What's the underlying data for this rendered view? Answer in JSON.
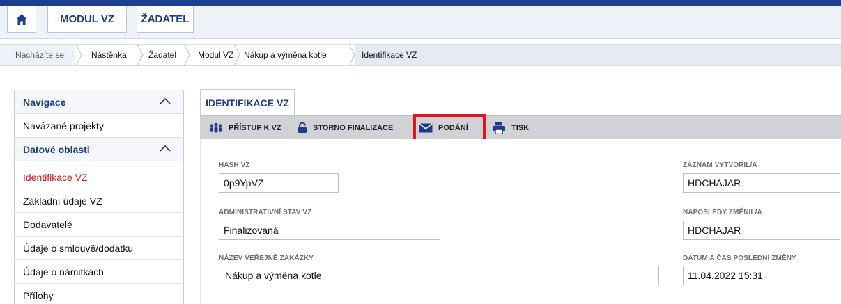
{
  "topbar": {
    "home_icon": "home-icon",
    "modul_label": "MODUL VZ",
    "zadatel_label": "ŽADATEL"
  },
  "breadcrumb": {
    "lead": "Nacházíte se:",
    "items": [
      "Nástěnka",
      "Žadatel",
      "Modul VZ",
      "Nákup a výměna kotle",
      "Identifikace VZ"
    ]
  },
  "sidebar": {
    "navigace": "Navigace",
    "navazane": "Navázané projekty",
    "datove": "Datové oblasti",
    "items": [
      "Identifikace VZ",
      "Základní údaje VZ",
      "Dodavatelé",
      "Údaje o smlouvě/dodatku",
      "Údaje o námitkách",
      "Přílohy"
    ]
  },
  "tab": {
    "label": "IDENTIFIKACE VZ"
  },
  "toolbar": {
    "pristup": "PŘÍSTUP K VZ",
    "storno": "STORNO FINALIZACE",
    "podani": "PODÁNÍ",
    "tisk": "TISK"
  },
  "form": {
    "hash_label": "HASH VZ",
    "hash_value": "0p9YpVZ",
    "stav_label": "ADMINISTRATIVNÍ STAV VZ",
    "stav_value": "Finalizovaná",
    "nazev_label": "NÁZEV VEŘEJNÉ ZAKÁZKY",
    "nazev_value": "Nákup a výměna kotle",
    "vytvoril_label": "ZÁZNAM VYTVOŘIL/A",
    "vytvoril_value": "HDCHAJAR",
    "zmenil_label": "NAPOSLEDY ZMĚNIL/A",
    "zmenil_value": "HDCHAJAR",
    "datum_label": "DATUM A ČAS POSLEDNÍ ZMĚNY",
    "datum_value": "11.04.2022 15:31"
  },
  "colors": {
    "accent": "#1e3a8a",
    "active": "#d31c1c",
    "highlight": "#e3141b"
  }
}
